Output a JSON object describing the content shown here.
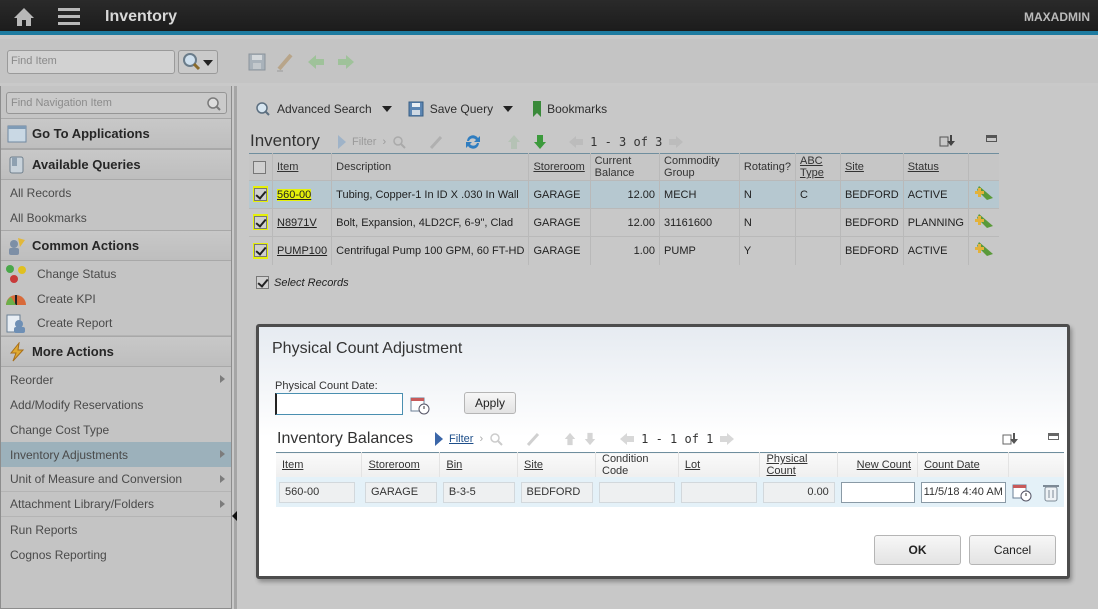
{
  "app": {
    "title": "Inventory",
    "user": "MAXADMIN",
    "icons": [
      "home-icon",
      "menu-icon"
    ]
  },
  "toolbar": {
    "find_placeholder": "Find Item",
    "icons": [
      "search-icon",
      "save-icon",
      "clear-icon",
      "previous-record-icon",
      "next-record-icon"
    ]
  },
  "sidebar": {
    "search_placeholder": "Find Navigation Item",
    "go_to_apps": "Go To Applications",
    "queries_title": "Available Queries",
    "queries": [
      "All Records",
      "All Bookmarks"
    ],
    "common_title": "Common Actions",
    "common": [
      "Change Status",
      "Create KPI",
      "Create Report"
    ],
    "more_title": "More Actions",
    "more": [
      {
        "label": "Reorder",
        "submenu": true
      },
      {
        "label": "Add/Modify Reservations",
        "submenu": false
      },
      {
        "label": "Change Cost Type",
        "submenu": false
      },
      {
        "label": "Inventory Adjustments",
        "submenu": true,
        "selected": true
      },
      {
        "label": "Unit of Measure and Conversion",
        "submenu": true
      },
      {
        "label": "Attachment Library/Folders",
        "submenu": true
      },
      {
        "label": "Run Reports",
        "submenu": false
      },
      {
        "label": "Cognos Reporting",
        "submenu": false
      }
    ]
  },
  "querybar": {
    "advanced_search": "Advanced Search",
    "save_query": "Save Query",
    "bookmarks": "Bookmarks"
  },
  "inventory_grid": {
    "title": "Inventory",
    "filter_label": "Filter",
    "pagination": "1 - 3 of 3",
    "columns": [
      "Item",
      "Description",
      "Storeroom",
      "Current Balance",
      "Commodity Group",
      "Rotating?",
      "ABC Type",
      "Site",
      "Status"
    ],
    "rows": [
      {
        "item": "560-00",
        "description": "Tubing, Copper-1 In ID X .030 In Wall",
        "storeroom": "GARAGE",
        "balance": "12.00",
        "commodity": "MECH",
        "rotating": "N",
        "abc": "C",
        "site": "BEDFORD",
        "status": "ACTIVE",
        "checked": true
      },
      {
        "item": "N8971V",
        "description": "Bolt, Expansion, 4LD2CF, 6-9\", Clad",
        "storeroom": "GARAGE",
        "balance": "12.00",
        "commodity": "31161600",
        "rotating": "N",
        "abc": "",
        "site": "BEDFORD",
        "status": "PLANNING",
        "checked": true
      },
      {
        "item": "PUMP100",
        "description": "Centrifugal Pump 100 GPM, 60 FT-HD",
        "storeroom": "GARAGE",
        "balance": "1.00",
        "commodity": "PUMP",
        "rotating": "Y",
        "abc": "",
        "site": "BEDFORD",
        "status": "ACTIVE",
        "checked": true
      }
    ],
    "select_records": "Select Records"
  },
  "dialog": {
    "title": "Physical Count Adjustment",
    "date_label": "Physical Count Date:",
    "date_value": "",
    "apply": "Apply",
    "balances": {
      "title": "Inventory Balances",
      "filter_label": "Filter",
      "pagination": "1 - 1 of 1",
      "columns": [
        "Item",
        "Storeroom",
        "Bin",
        "Site",
        "Condition Code",
        "Lot",
        "Physical Count",
        "New Count",
        "Count Date"
      ],
      "rows": [
        {
          "item": "560-00",
          "storeroom": "GARAGE",
          "bin": "B-3-5",
          "site": "BEDFORD",
          "condition_code": "",
          "lot": "",
          "physical_count": "0.00",
          "new_count": "",
          "count_date": "11/5/18 4:40 AM"
        }
      ]
    },
    "ok": "OK",
    "cancel": "Cancel"
  },
  "colors": {
    "accent": "#1d7ba0",
    "highlight": "#e5f00a",
    "selected_row": "#b6c8d0",
    "selected_nav": "#9cb1bb"
  }
}
